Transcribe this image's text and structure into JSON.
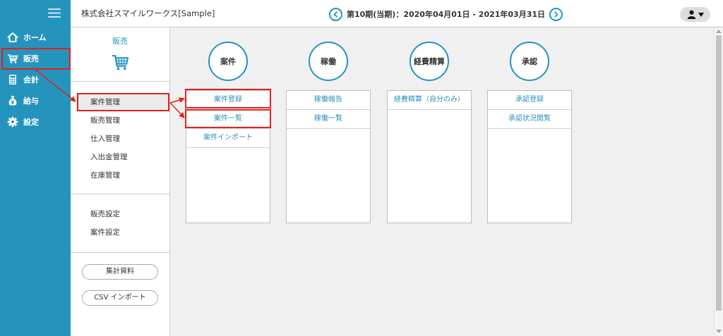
{
  "colors": {
    "accent": "#2494bd",
    "annotation": "#e3201b",
    "content_bg": "#f0f0f0",
    "selected_bg": "#ebebeb",
    "link": "#2e8fba"
  },
  "sidebar": {
    "menu_icon": "hamburger-menu-icon",
    "items": [
      {
        "label": "ホーム",
        "icon": "home-icon"
      },
      {
        "label": "販売",
        "icon": "cart-icon"
      },
      {
        "label": "会計",
        "icon": "calculator-icon"
      },
      {
        "label": "給与",
        "icon": "money-bag-icon"
      },
      {
        "label": "設定",
        "icon": "gear-icon"
      }
    ]
  },
  "header": {
    "company": "株式会社スマイルワークス[Sample]",
    "prev_icon": "chevron-left-circle-icon",
    "period": "第10期(当期)：2020年04月01日 - 2021年03月31日",
    "next_icon": "chevron-right-circle-icon",
    "user_icon": "user-icon",
    "user_caret_icon": "caret-down-icon"
  },
  "submenu": {
    "title": "販売",
    "title_icon": "cart-icon",
    "primary_items": [
      "案件管理",
      "販売管理",
      "仕入管理",
      "入出金管理",
      "在庫管理"
    ],
    "selected_index": 0,
    "settings_items": [
      "販売設定",
      "案件設定"
    ],
    "buttons": [
      "集計資料",
      "CSV インポート"
    ]
  },
  "main": {
    "groups": [
      {
        "title": "案件",
        "items": [
          "案件登録",
          "案件一覧",
          "案件インポート"
        ]
      },
      {
        "title": "稼働",
        "items": [
          "稼働報告",
          "稼働一覧"
        ]
      },
      {
        "title": "経費精算",
        "items": [
          "経費精算（自分のみ）"
        ]
      },
      {
        "title": "承認",
        "items": [
          "承認登録",
          "承認状況閲覧"
        ]
      }
    ]
  },
  "scrollbar": {
    "position": 0,
    "visible_fraction": 0.94
  }
}
